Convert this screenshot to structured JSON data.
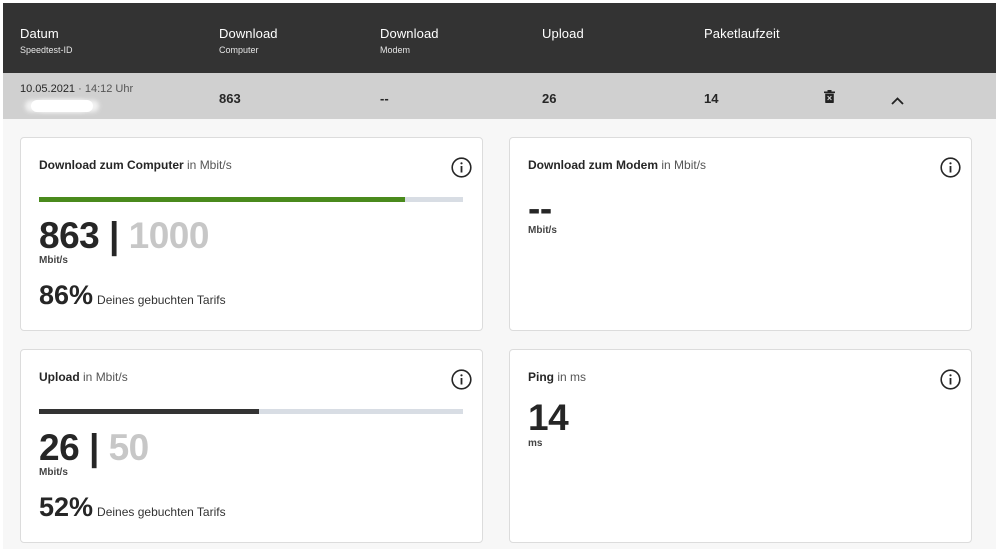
{
  "header": {
    "col1": {
      "title": "Datum",
      "sub": "Speedtest-ID"
    },
    "col2": {
      "title": "Download",
      "sub": "Computer"
    },
    "col3": {
      "title": "Download",
      "sub": "Modem"
    },
    "col4": {
      "title": "Upload"
    },
    "col5": {
      "title": "Paketlaufzeit"
    }
  },
  "row": {
    "date": "10.05.2021",
    "sep": " · ",
    "time": "14:12 Uhr",
    "download_computer": "863",
    "download_modem": "--",
    "upload": "26",
    "latency": "14",
    "delete_icon": "trash-icon",
    "collapse_icon": "chevron-up-icon"
  },
  "cards": {
    "download_computer": {
      "title": "Download zum Computer",
      "unit_label": "in Mbit/s",
      "value": "863",
      "separator": "|",
      "max": "1000",
      "unit": "Mbit/s",
      "percent": "86%",
      "percent_label": "Deines gebuchten Tarifs",
      "progress_fraction": 0.863,
      "bar_color": "#4a8a1c"
    },
    "download_modem": {
      "title": "Download zum Modem",
      "unit_label": "in Mbit/s",
      "value": "--",
      "unit": "Mbit/s"
    },
    "upload": {
      "title": "Upload",
      "unit_label": "in Mbit/s",
      "value": "26",
      "separator": "|",
      "max": "50",
      "unit": "Mbit/s",
      "percent": "52%",
      "percent_label": "Deines gebuchten Tarifs",
      "progress_fraction": 0.52,
      "bar_color": "#333333"
    },
    "ping": {
      "title": "Ping",
      "unit_label": "in ms",
      "value": "14",
      "unit": "ms"
    }
  },
  "colors": {
    "header_bg": "#333333",
    "row_bg": "#d0d0d0",
    "track": "#d8dde4",
    "max_text": "#c7c7c7"
  }
}
